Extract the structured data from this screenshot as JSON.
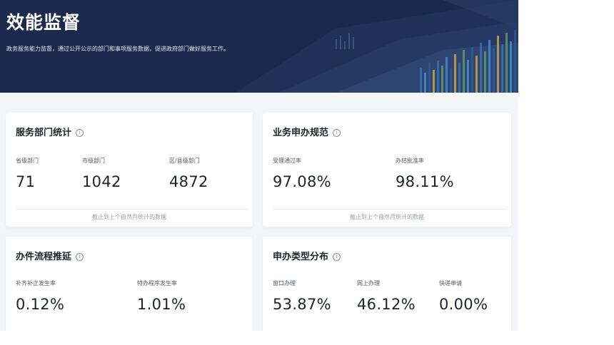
{
  "header": {
    "title": "效能监督",
    "subtitle": "政务服务能力监督，通过公开公示的部门和事项服务数据，促进政府部门做好服务工作。"
  },
  "cards": {
    "dept": {
      "title": "服务部门统计",
      "info_icon": "info-circle-icon",
      "metrics": [
        {
          "label": "省级部门",
          "value": "71"
        },
        {
          "label": "市级部门",
          "value": "1042"
        },
        {
          "label": "区/县级部门",
          "value": "4872"
        }
      ],
      "footnote": "截止到上个自然月统计的数据"
    },
    "business": {
      "title": "业务申办规范",
      "info_icon": "info-circle-icon",
      "metrics": [
        {
          "label": "受理通过率",
          "value": "97.08%"
        },
        {
          "label": "办结批准率",
          "value": "98.11%"
        }
      ],
      "footnote": "截止到上个自然月统计的数据"
    },
    "delay": {
      "title": "办件流程推延",
      "info_icon": "info-circle-icon",
      "metrics": [
        {
          "label": "补齐补正发生率",
          "value": "0.12%"
        },
        {
          "label": "特办程序发生率",
          "value": "1.01%"
        }
      ]
    },
    "types": {
      "title": "申办类型分布",
      "info_icon": "info-circle-icon",
      "metrics": [
        {
          "label": "窗口办理",
          "value": "53.87%"
        },
        {
          "label": "网上办理",
          "value": "46.12%"
        },
        {
          "label": "快递申请",
          "value": "0.00%"
        }
      ]
    }
  }
}
